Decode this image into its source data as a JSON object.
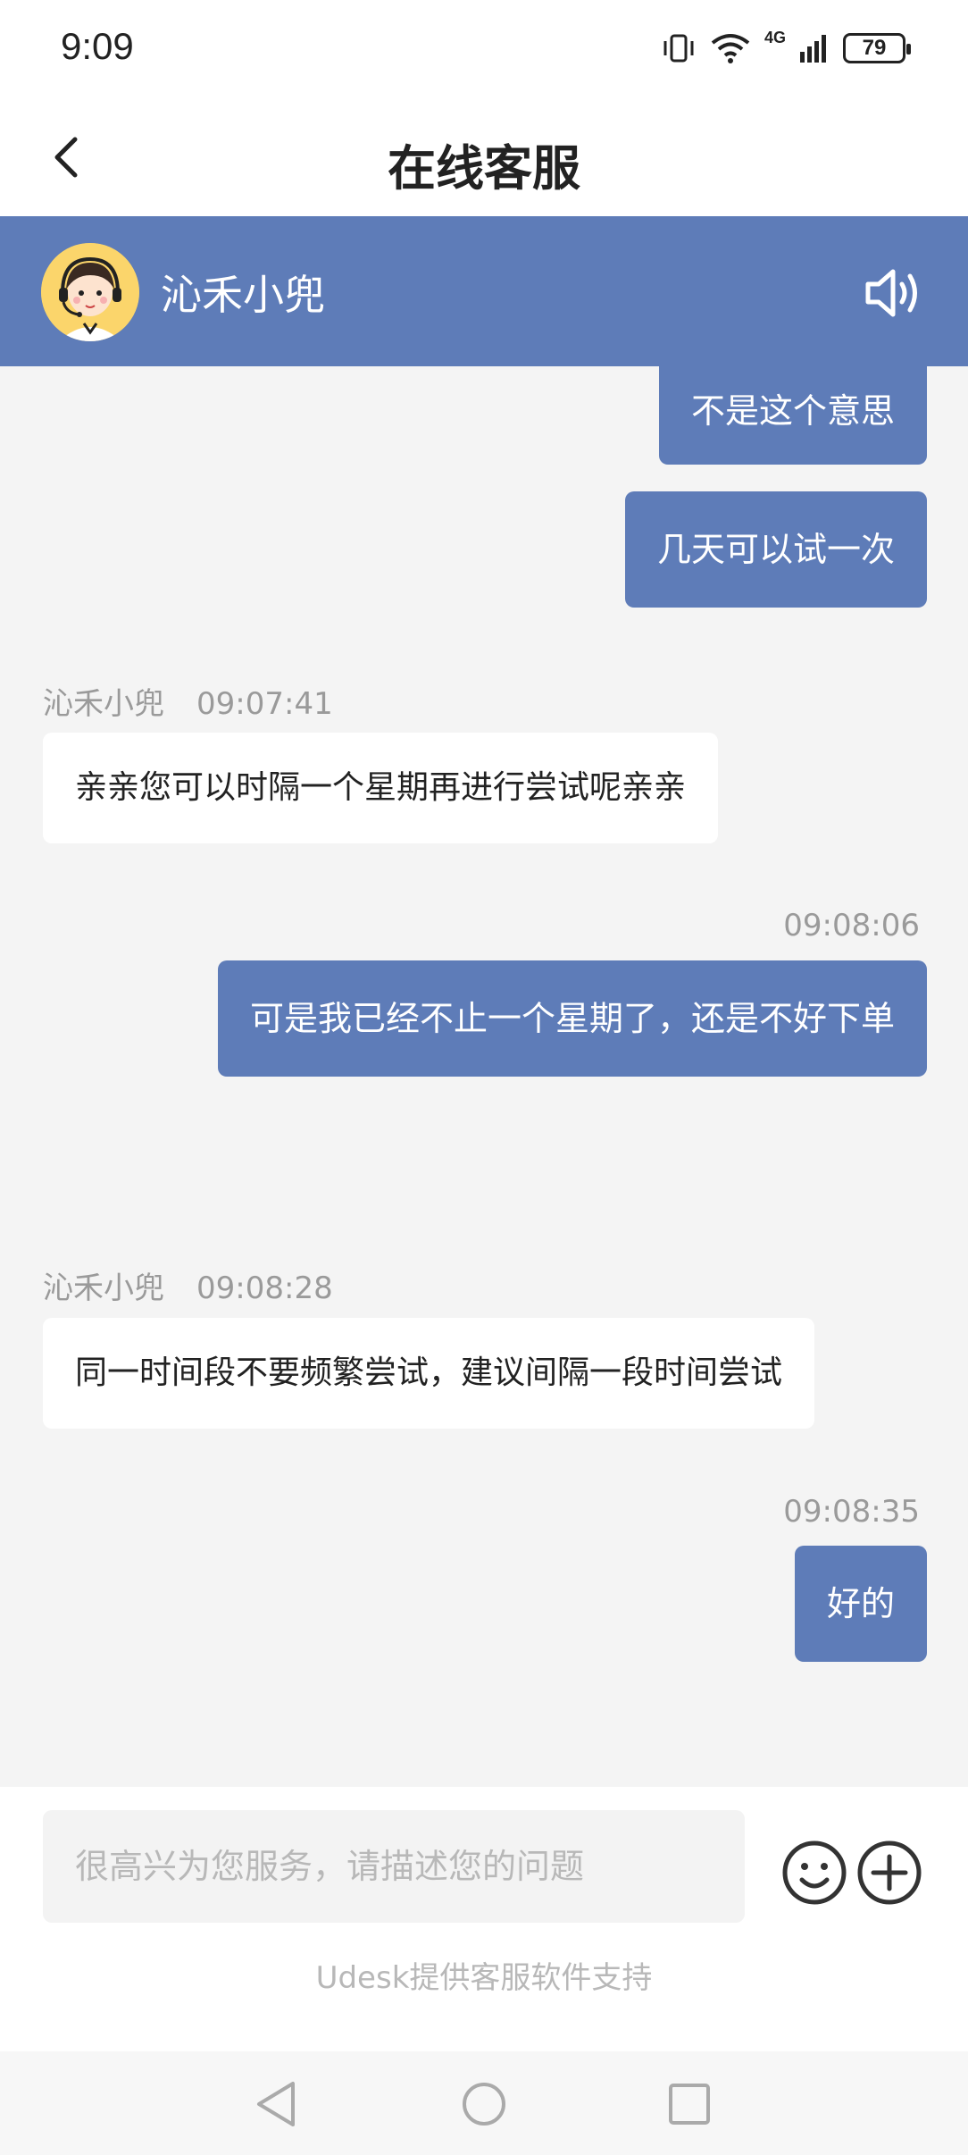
{
  "status_bar": {
    "time": "9:09",
    "battery": "79",
    "network": "4G"
  },
  "header": {
    "title": "在线客服"
  },
  "agent": {
    "name": "沁禾小兜"
  },
  "messages": [
    {
      "side": "right",
      "text": "不是这个意思"
    },
    {
      "side": "right",
      "text": "几天可以试一次"
    },
    {
      "side": "left",
      "sender": "沁禾小兜",
      "time": "09:07:41",
      "text": "亲亲您可以时隔一个星期再进行尝试呢亲亲"
    },
    {
      "side": "right",
      "time": "09:08:06",
      "text": "可是我已经不止一个星期了，还是不好下单"
    },
    {
      "side": "left",
      "sender": "沁禾小兜",
      "time": "09:08:28",
      "text": "同一时间段不要频繁尝试，建议间隔一段时间尝试"
    },
    {
      "side": "right",
      "time": "09:08:35",
      "text": "好的"
    }
  ],
  "input": {
    "placeholder": "很高兴为您服务，请描述您的问题",
    "value": ""
  },
  "footer": {
    "powered_by": "Udesk提供客服软件支持"
  },
  "colors": {
    "accent": "#5e7cb8",
    "chat_bg": "#f4f4f4",
    "bubble_left": "#ffffff"
  }
}
